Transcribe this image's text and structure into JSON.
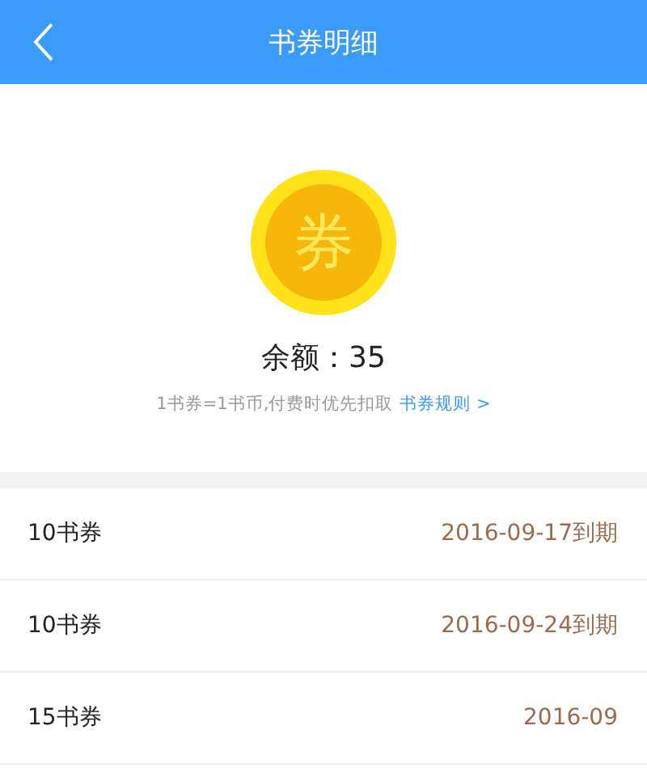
{
  "header": {
    "title": "书券明细"
  },
  "coin": {
    "glyph": "券"
  },
  "balance": "余额：35",
  "note": {
    "text": "1书券=1书币,付费时优先扣取",
    "link": "书券规则 >"
  },
  "coupons": [
    {
      "name": "10书券",
      "expiry": "2016-09-17到期"
    },
    {
      "name": "10书券",
      "expiry": "2016-09-24到期"
    },
    {
      "name": "15书券",
      "expiry": "2016-09"
    }
  ]
}
